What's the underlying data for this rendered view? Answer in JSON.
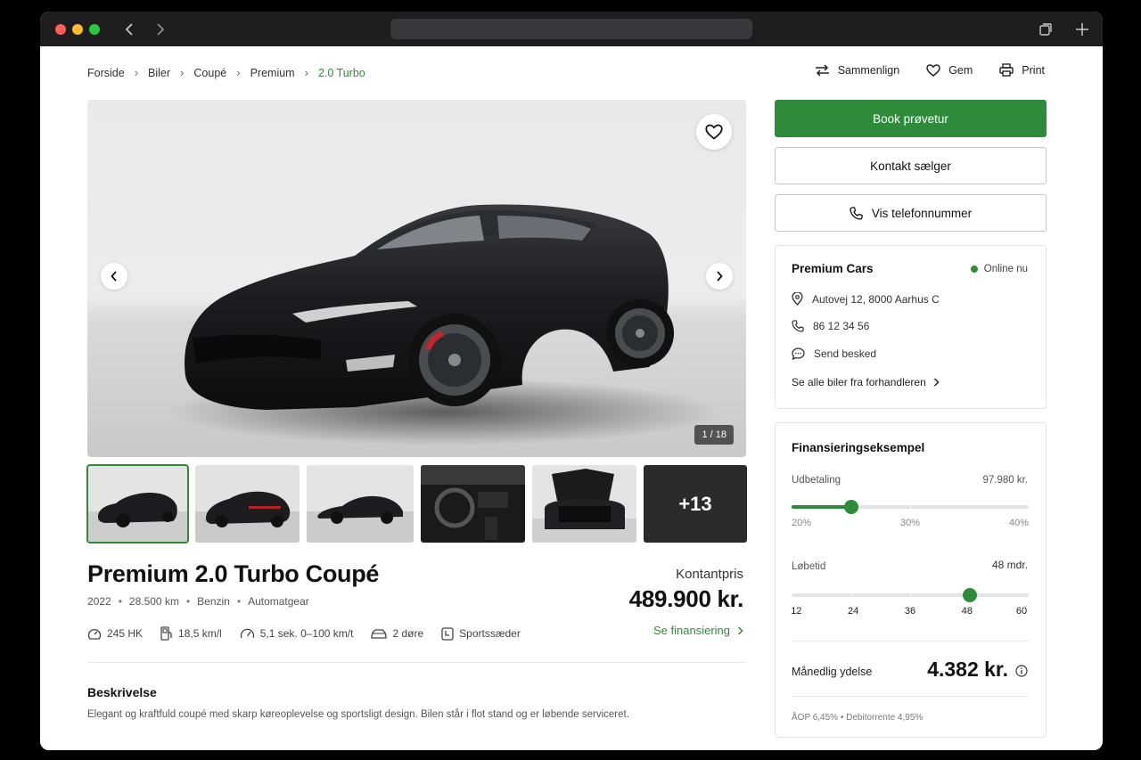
{
  "browser": {
    "url": ""
  },
  "breadcrumb": [
    "Forside",
    "Biler",
    "Coupé",
    "Premium",
    "2.0 Turbo"
  ],
  "top_actions": {
    "compare": "Sammenlign",
    "save": "Gem",
    "print": "Print"
  },
  "gallery": {
    "counter": "1 / 18",
    "more_label": "+13"
  },
  "listing": {
    "title": "Premium 2.0 Turbo Coupé",
    "year": "2022",
    "mileage": "28.500 km",
    "fuel": "Benzin",
    "gearbox": "Automatgear",
    "specs": {
      "power": "245 HK",
      "consumption": "18,5 km/l",
      "acceleration": "5,1 sek. 0–100 km/t",
      "doors": "2 døre",
      "seats": "Sportssæder"
    },
    "price_label": "Kontantpris",
    "price": "489.900 kr.",
    "finance_link": "Se finansiering",
    "description_title": "Beskrivelse",
    "description": "Elegant og kraftfuld coupé med skarp køreoplevelse og sportsligt design. Bilen står i flot stand og er løbende serviceret."
  },
  "cta": {
    "book": "Book prøvetur",
    "contact": "Kontakt sælger",
    "phone": "Vis telefonnummer"
  },
  "dealer": {
    "name": "Premium Cars",
    "status": "Online nu",
    "address": "Autovej 12, 8000 Aarhus C",
    "phone": "86 12 34 56",
    "message": "Send besked",
    "all_cars": "Se alle biler fra forhandleren"
  },
  "finance": {
    "title": "Finansieringseksempel",
    "down_payment_label": "Udbetaling",
    "down_payment_value": "97.980 kr.",
    "down_payment_percent": 0.25,
    "down_payment_ticks": [
      "20%",
      "30%",
      "40%"
    ],
    "term_label": "Løbetid",
    "term_value": "48 mdr.",
    "term_selected": 48,
    "term_ticks": [
      "12",
      "24",
      "36",
      "48",
      "60"
    ],
    "monthly_label": "Månedlig ydelse",
    "monthly_value": "4.382 kr.",
    "footnote": "ÅOP 6,45%   •   Debitorrente 4,95%"
  },
  "colors": {
    "accent": "#2e8b3a"
  }
}
